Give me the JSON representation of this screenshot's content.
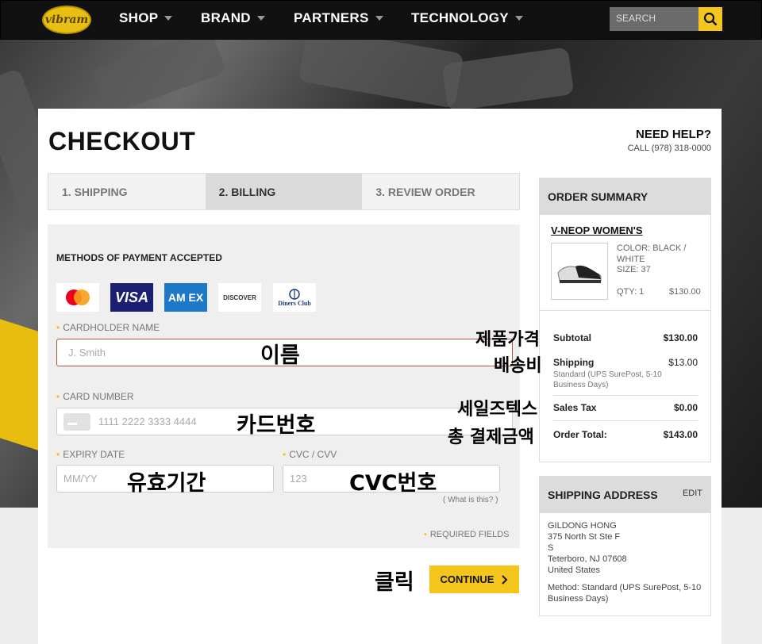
{
  "nav": {
    "logo": "vibram",
    "items": [
      "SHOP",
      "BRAND",
      "PARTNERS",
      "TECHNOLOGY"
    ],
    "search_placeholder": "SEARCH"
  },
  "page": {
    "title": "CHECKOUT",
    "help_title": "NEED HELP?",
    "help_phone": "CALL (978) 318-0000"
  },
  "steps": [
    "1. SHIPPING",
    "2. BILLING",
    "3. REVIEW ORDER"
  ],
  "payment": {
    "heading": "METHODS OF PAYMENT ACCEPTED",
    "cards": {
      "mastercard": "",
      "visa": "VISA",
      "amex": "AM EX",
      "discover": "DISCOVER",
      "diners": "Diners Club"
    },
    "cardholder_label": "CARDHOLDER NAME",
    "cardholder_placeholder": "J. Smith",
    "number_label": "CARD NUMBER",
    "number_placeholder": "1111 2222 3333 4444",
    "expiry_label": "EXPIRY DATE",
    "expiry_placeholder": "MM/YY",
    "cvc_label": "CVC / CVV",
    "cvc_placeholder": "123",
    "whatis": "( What is this? )",
    "required": "REQUIRED FIELDS",
    "continue": "CONTINUE"
  },
  "summary": {
    "heading": "ORDER SUMMARY",
    "product": "V-NEOP WOMEN'S",
    "color": "COLOR: BLACK / WHITE",
    "size": "SIZE: 37",
    "qty": "QTY: 1",
    "price": "$130.00",
    "subtotal_label": "Subtotal",
    "subtotal": "$130.00",
    "shipping_label": "Shipping",
    "shipping": "$13.00",
    "shipping_method": "Standard (UPS SurePost, 5-10 Business Days)",
    "tax_label": "Sales Tax",
    "tax": "$0.00",
    "total_label": "Order Total:",
    "total": "$143.00"
  },
  "address": {
    "heading": "SHIPPING ADDRESS",
    "edit": "EDIT",
    "name": "GILDONG HONG",
    "line1": "375 North St Ste F",
    "line2": "S",
    "line3": "Teterboro, NJ 07608",
    "country": "United States",
    "method": "Method: Standard (UPS SurePost, 5-10 Business Days)"
  },
  "annotations": {
    "name": "이름",
    "card_number": "카드번호",
    "expiry": "유효기간",
    "cvc": "CVC번호",
    "product_price": "제품가격",
    "shipping": "배송비",
    "sales_tax": "세일즈텍스",
    "total": "총 결제금액",
    "click": "클릭"
  },
  "colors": {
    "accent": "#f4c51a",
    "nav_bg": "#111111",
    "panel_bg": "#efefef"
  }
}
